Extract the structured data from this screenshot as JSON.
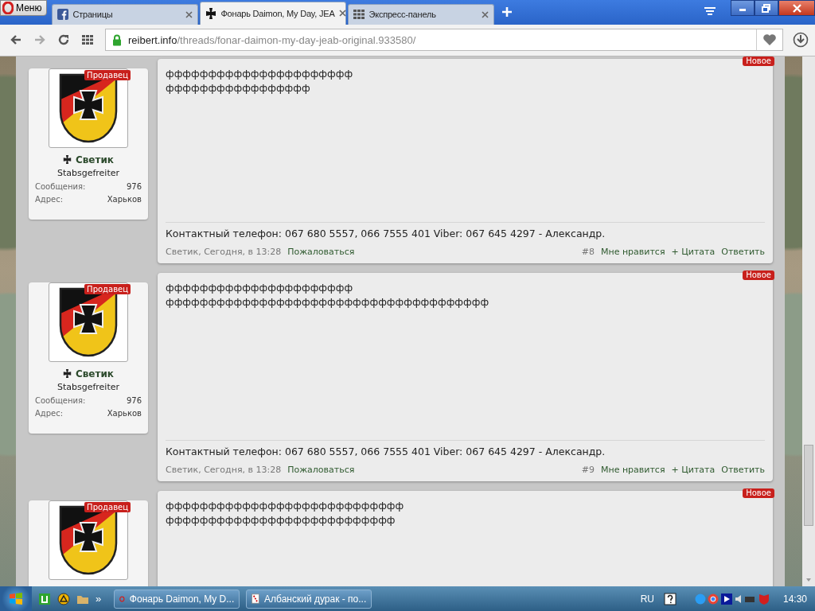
{
  "browser": {
    "menu_label": "Меню",
    "tabs": [
      {
        "title": "Страницы",
        "kind": "facebook",
        "selected": false
      },
      {
        "title": "Фонарь Daimon, My Day, JEA",
        "kind": "cross",
        "selected": true
      },
      {
        "title": "Экспресс-панель",
        "kind": "grid",
        "selected": false
      }
    ],
    "url_host": "reibert.info",
    "url_path": "/threads/fonar-daimon-my-day-jeab-original.933580/"
  },
  "posts": [
    {
      "badge": "Новое",
      "role": "Продавец",
      "username": "Светик",
      "rank": "Stabsgefreiter",
      "stats": [
        {
          "label": "Сообщения:",
          "value": "976"
        },
        {
          "label": "Адрес:",
          "value": "Харьков"
        }
      ],
      "lines": [
        "фффффффффффффффффффффф",
        "ффффффффффффффффф"
      ],
      "contact": "Контактный телефон: 067 680 5557, 066 7555 401 Viber: 067 645 4297 - Александр.",
      "meta": "Светик, Сегодня, в 13:28",
      "report": "Пожаловаться",
      "number": "#8",
      "actions": [
        "Мне нравится",
        "+ Цитата",
        "Ответить"
      ]
    },
    {
      "badge": "Новое",
      "role": "Продавец",
      "username": "Светик",
      "rank": "Stabsgefreiter",
      "stats": [
        {
          "label": "Сообщения:",
          "value": "976"
        },
        {
          "label": "Адрес:",
          "value": "Харьков"
        }
      ],
      "lines": [
        "фффффффффффффффффффффф",
        "фффффффффффффффффффффффффффффффффффффф"
      ],
      "contact": "Контактный телефон: 067 680 5557, 066 7555 401 Viber: 067 645 4297 - Александр.",
      "meta": "Светик, Сегодня, в 13:28",
      "report": "Пожаловаться",
      "number": "#9",
      "actions": [
        "Мне нравится",
        "+ Цитата",
        "Ответить"
      ]
    },
    {
      "badge": "Новое",
      "role": "Продавец",
      "lines": [
        "фффффффффффффффффффффффффффф",
        "ффффффффффффффффффффффффффф"
      ]
    }
  ],
  "taskbar": {
    "items": [
      {
        "title": "Фонарь Daimon, My D...",
        "kind": "opera"
      },
      {
        "title": "Албанский дурак - по...",
        "kind": "cards"
      }
    ],
    "more": "»",
    "language": "RU",
    "clock": "14:30"
  }
}
